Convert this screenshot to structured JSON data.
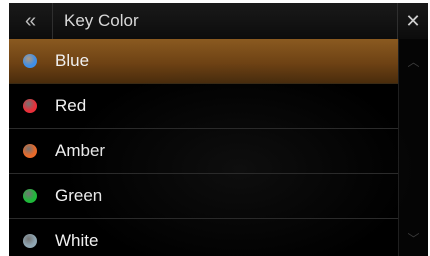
{
  "header": {
    "back_icon": "double-chevron-left-icon",
    "back_glyph": "«",
    "title": "Key Color",
    "close_icon": "close-icon",
    "close_glyph": "✕"
  },
  "list": {
    "items": [
      {
        "label": "Blue",
        "color": "#3f8fe8",
        "selected": true
      },
      {
        "label": "Red",
        "color": "#e8303a",
        "selected": false
      },
      {
        "label": "Amber",
        "color": "#e86a2a",
        "selected": false
      },
      {
        "label": "Green",
        "color": "#1fb83a",
        "selected": false
      },
      {
        "label": "White",
        "color": "#8fa6b3",
        "selected": false
      }
    ]
  },
  "scrollbar": {
    "up_icon": "chevron-up-icon",
    "up_glyph": "︿",
    "down_icon": "chevron-down-icon",
    "down_glyph": "﹀"
  },
  "colors": {
    "selected_row": "#7a4a18",
    "background": "#000000"
  }
}
